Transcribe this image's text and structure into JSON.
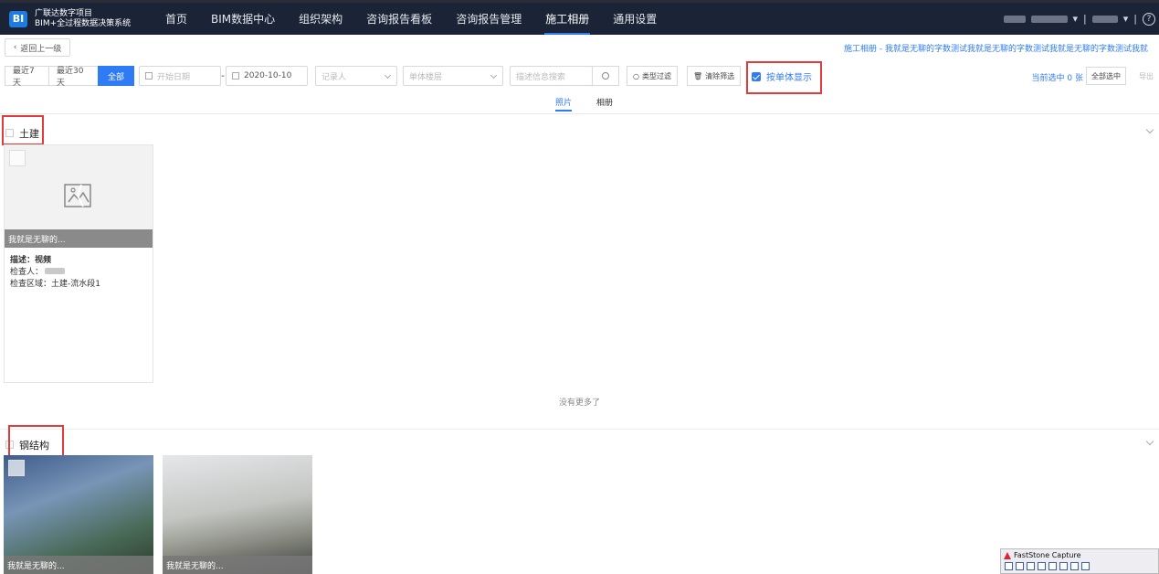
{
  "header": {
    "logo_badge": "BI",
    "logo_line1": "广联达数字项目",
    "logo_line2": "BIM+全过程数据决策系统",
    "nav": [
      {
        "label": "首页"
      },
      {
        "label": "BIM数据中心"
      },
      {
        "label": "组织架构"
      },
      {
        "label": "咨询报告看板"
      },
      {
        "label": "咨询报告管理"
      },
      {
        "label": "施工相册",
        "active": true
      },
      {
        "label": "通用设置"
      }
    ],
    "help_icon": "?"
  },
  "toolbar": {
    "back_label": "返回上一级",
    "breadcrumb": "施工相册 - 我就是无聊的字数测试我就是无聊的字数测试我就是无聊的字数测试我就"
  },
  "filters": {
    "range_buttons": [
      "最近7天",
      "最近30天",
      "全部"
    ],
    "active_range": "全部",
    "start_date_placeholder": "开始日期",
    "end_date_value": "2020-10-10",
    "recorder_placeholder": "记录人",
    "building_placeholder": "单体楼层",
    "search_placeholder": "描述信息搜索",
    "type_filter_label": "类型过滤",
    "clear_filter_label": "清除筛选",
    "by_building_label": "按单体显示",
    "selected_count": "当前选中 0 张",
    "select_all_label": "全部选中",
    "export_label": "导出"
  },
  "tabs": [
    {
      "label": "照片",
      "active": true
    },
    {
      "label": "相册"
    }
  ],
  "sections": [
    {
      "title": "土建",
      "cards": [
        {
          "caption": "我就是无聊的...",
          "desc_label": "描述：视频",
          "inspector_label": "检查人：",
          "area_label": "检查区域：土建-流水段1"
        }
      ],
      "footer": "没有更多了"
    },
    {
      "title": "钢结构",
      "cards": [
        {
          "caption": "我就是无聊的..."
        },
        {
          "caption": "我就是无聊的..."
        }
      ]
    }
  ],
  "overlay": {
    "app_name": "FastStone Capture"
  },
  "colors": {
    "accent": "#2f7bf5",
    "nav_bg": "#1b2436",
    "highlight": "#e23b3b"
  }
}
